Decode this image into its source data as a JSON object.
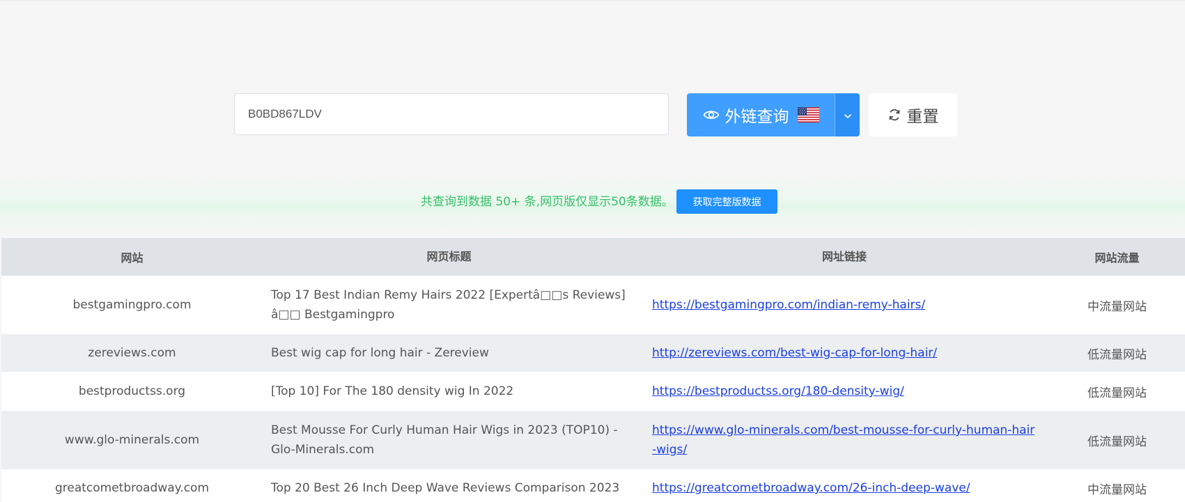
{
  "search": {
    "value": "B0BD867LDV",
    "query_label": "外链查询",
    "reset_label": "重置"
  },
  "notice": {
    "text": "共查询到数据 50+ 条,网页版仅显示50条数据。",
    "button_label": "获取完整版数据"
  },
  "table": {
    "headers": [
      "网站",
      "网页标题",
      "网址链接",
      "网站流量"
    ],
    "rows": [
      {
        "site": "bestgamingpro.com",
        "title": "Top 17 Best Indian Remy Hairs 2022 [Expertâ□□s Reviews] â□□ Bestgamingpro",
        "url": "https://bestgamingpro.com/indian-remy-hairs/",
        "traffic": "中流量网站"
      },
      {
        "site": "zereviews.com",
        "title": "Best wig cap for long hair - Zereview",
        "url": "http://zereviews.com/best-wig-cap-for-long-hair/",
        "traffic": "低流量网站"
      },
      {
        "site": "bestproductss.org",
        "title": "[Top 10] For The 180 density wig In 2022",
        "url": "https://bestproductss.org/180-density-wig/",
        "traffic": "低流量网站"
      },
      {
        "site": "www.glo-minerals.com",
        "title": "Best Mousse For Curly Human Hair Wigs in 2023 (TOP10) - Glo-Minerals.com",
        "url": "https://www.glo-minerals.com/best-mousse-for-curly-human-hair-wigs/",
        "traffic": "低流量网站"
      },
      {
        "site": "greatcometbroadway.com",
        "title": "Top 20 Best 26 Inch Deep Wave Reviews Comparison 2023",
        "url": "https://greatcometbroadway.com/26-inch-deep-wave/",
        "traffic": "中流量网站"
      }
    ]
  }
}
